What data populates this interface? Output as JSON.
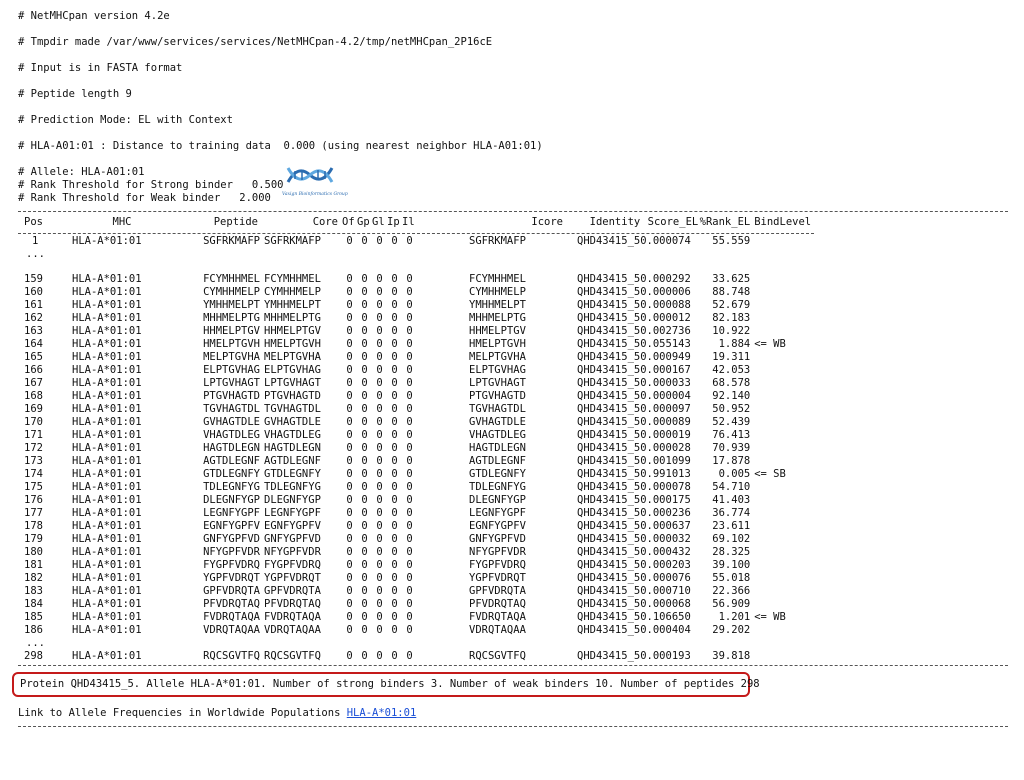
{
  "header": {
    "version": "# NetMHCpan version 4.2e",
    "tmpdir": "# Tmpdir made /var/www/services/services/NetMHCpan-4.2/tmp/netMHCpan_2P16cE",
    "input": "# Input is in FASTA format",
    "peptide_length": "# Peptide length 9",
    "prediction_mode": "# Prediction Mode: EL with Context",
    "distance": "# HLA-A01:01 : Distance to training data  0.000 (using nearest neighbor HLA-A01:01)",
    "allele": "# Allele: HLA-A01:01",
    "strong_threshold": "# Rank Threshold for Strong binder   0.500",
    "weak_threshold": "# Rank Threshold for Weak binder   2.000"
  },
  "logo": {
    "name": "dna-logo-icon",
    "caption": "Vaxign Bioinformatics Group",
    "color": "#2b6cb0"
  },
  "table": {
    "columns": [
      "Pos",
      "MHC",
      "Peptide",
      "Core",
      "Of",
      "Gp",
      "Gl",
      "Ip",
      "Il",
      "Icore",
      "Identity",
      "Score_EL",
      "%Rank_EL",
      "BindLevel"
    ],
    "first_row": {
      "pos": "1",
      "mhc": "HLA-A*01:01",
      "peptide": "SGFRKMAFP",
      "core": "SGFRKMAFP",
      "of": "0",
      "gp": "0",
      "gl": "0",
      "ip": "0",
      "il": "0",
      "icore": "SGFRKMAFP",
      "identity": "QHD43415_5",
      "score": "0.000074",
      "rank": "55.559",
      "bind": ""
    },
    "ellipsis": "...",
    "rows": [
      {
        "pos": "159",
        "mhc": "HLA-A*01:01",
        "peptide": "FCYMHHMEL",
        "core": "FCYMHHMEL",
        "icore": "FCYMHHMEL",
        "identity": "QHD43415_5",
        "score": "0.000292",
        "rank": "33.625",
        "bind": ""
      },
      {
        "pos": "160",
        "mhc": "HLA-A*01:01",
        "peptide": "CYMHHMELP",
        "core": "CYMHHMELP",
        "icore": "CYMHHMELP",
        "identity": "QHD43415_5",
        "score": "0.000006",
        "rank": "88.748",
        "bind": ""
      },
      {
        "pos": "161",
        "mhc": "HLA-A*01:01",
        "peptide": "YMHHMELPT",
        "core": "YMHHMELPT",
        "icore": "YMHHMELPT",
        "identity": "QHD43415_5",
        "score": "0.000088",
        "rank": "52.679",
        "bind": ""
      },
      {
        "pos": "162",
        "mhc": "HLA-A*01:01",
        "peptide": "MHHMELPTG",
        "core": "MHHMELPTG",
        "icore": "MHHMELPTG",
        "identity": "QHD43415_5",
        "score": "0.000012",
        "rank": "82.183",
        "bind": ""
      },
      {
        "pos": "163",
        "mhc": "HLA-A*01:01",
        "peptide": "HHMELPTGV",
        "core": "HHMELPTGV",
        "icore": "HHMELPTGV",
        "identity": "QHD43415_5",
        "score": "0.002736",
        "rank": "10.922",
        "bind": ""
      },
      {
        "pos": "164",
        "mhc": "HLA-A*01:01",
        "peptide": "HMELPTGVH",
        "core": "HMELPTGVH",
        "icore": "HMELPTGVH",
        "identity": "QHD43415_5",
        "score": "0.055143",
        "rank": "1.884",
        "bind": "<= WB"
      },
      {
        "pos": "165",
        "mhc": "HLA-A*01:01",
        "peptide": "MELPTGVHA",
        "core": "MELPTGVHA",
        "icore": "MELPTGVHA",
        "identity": "QHD43415_5",
        "score": "0.000949",
        "rank": "19.311",
        "bind": ""
      },
      {
        "pos": "166",
        "mhc": "HLA-A*01:01",
        "peptide": "ELPTGVHAG",
        "core": "ELPTGVHAG",
        "icore": "ELPTGVHAG",
        "identity": "QHD43415_5",
        "score": "0.000167",
        "rank": "42.053",
        "bind": ""
      },
      {
        "pos": "167",
        "mhc": "HLA-A*01:01",
        "peptide": "LPTGVHAGT",
        "core": "LPTGVHAGT",
        "icore": "LPTGVHAGT",
        "identity": "QHD43415_5",
        "score": "0.000033",
        "rank": "68.578",
        "bind": ""
      },
      {
        "pos": "168",
        "mhc": "HLA-A*01:01",
        "peptide": "PTGVHAGTD",
        "core": "PTGVHAGTD",
        "icore": "PTGVHAGTD",
        "identity": "QHD43415_5",
        "score": "0.000004",
        "rank": "92.140",
        "bind": ""
      },
      {
        "pos": "169",
        "mhc": "HLA-A*01:01",
        "peptide": "TGVHAGTDL",
        "core": "TGVHAGTDL",
        "icore": "TGVHAGTDL",
        "identity": "QHD43415_5",
        "score": "0.000097",
        "rank": "50.952",
        "bind": ""
      },
      {
        "pos": "170",
        "mhc": "HLA-A*01:01",
        "peptide": "GVHAGTDLE",
        "core": "GVHAGTDLE",
        "icore": "GVHAGTDLE",
        "identity": "QHD43415_5",
        "score": "0.000089",
        "rank": "52.439",
        "bind": ""
      },
      {
        "pos": "171",
        "mhc": "HLA-A*01:01",
        "peptide": "VHAGTDLEG",
        "core": "VHAGTDLEG",
        "icore": "VHAGTDLEG",
        "identity": "QHD43415_5",
        "score": "0.000019",
        "rank": "76.413",
        "bind": ""
      },
      {
        "pos": "172",
        "mhc": "HLA-A*01:01",
        "peptide": "HAGTDLEGN",
        "core": "HAGTDLEGN",
        "icore": "HAGTDLEGN",
        "identity": "QHD43415_5",
        "score": "0.000028",
        "rank": "70.939",
        "bind": ""
      },
      {
        "pos": "173",
        "mhc": "HLA-A*01:01",
        "peptide": "AGTDLEGNF",
        "core": "AGTDLEGNF",
        "icore": "AGTDLEGNF",
        "identity": "QHD43415_5",
        "score": "0.001099",
        "rank": "17.878",
        "bind": ""
      },
      {
        "pos": "174",
        "mhc": "HLA-A*01:01",
        "peptide": "GTDLEGNFY",
        "core": "GTDLEGNFY",
        "icore": "GTDLEGNFY",
        "identity": "QHD43415_5",
        "score": "0.991013",
        "rank": "0.005",
        "bind": "<= SB"
      },
      {
        "pos": "175",
        "mhc": "HLA-A*01:01",
        "peptide": "TDLEGNFYG",
        "core": "TDLEGNFYG",
        "icore": "TDLEGNFYG",
        "identity": "QHD43415_5",
        "score": "0.000078",
        "rank": "54.710",
        "bind": ""
      },
      {
        "pos": "176",
        "mhc": "HLA-A*01:01",
        "peptide": "DLEGNFYGP",
        "core": "DLEGNFYGP",
        "icore": "DLEGNFYGP",
        "identity": "QHD43415_5",
        "score": "0.000175",
        "rank": "41.403",
        "bind": ""
      },
      {
        "pos": "177",
        "mhc": "HLA-A*01:01",
        "peptide": "LEGNFYGPF",
        "core": "LEGNFYGPF",
        "icore": "LEGNFYGPF",
        "identity": "QHD43415_5",
        "score": "0.000236",
        "rank": "36.774",
        "bind": ""
      },
      {
        "pos": "178",
        "mhc": "HLA-A*01:01",
        "peptide": "EGNFYGPFV",
        "core": "EGNFYGPFV",
        "icore": "EGNFYGPFV",
        "identity": "QHD43415_5",
        "score": "0.000637",
        "rank": "23.611",
        "bind": ""
      },
      {
        "pos": "179",
        "mhc": "HLA-A*01:01",
        "peptide": "GNFYGPFVD",
        "core": "GNFYGPFVD",
        "icore": "GNFYGPFVD",
        "identity": "QHD43415_5",
        "score": "0.000032",
        "rank": "69.102",
        "bind": ""
      },
      {
        "pos": "180",
        "mhc": "HLA-A*01:01",
        "peptide": "NFYGPFVDR",
        "core": "NFYGPFVDR",
        "icore": "NFYGPFVDR",
        "identity": "QHD43415_5",
        "score": "0.000432",
        "rank": "28.325",
        "bind": ""
      },
      {
        "pos": "181",
        "mhc": "HLA-A*01:01",
        "peptide": "FYGPFVDRQ",
        "core": "FYGPFVDRQ",
        "icore": "FYGPFVDRQ",
        "identity": "QHD43415_5",
        "score": "0.000203",
        "rank": "39.100",
        "bind": ""
      },
      {
        "pos": "182",
        "mhc": "HLA-A*01:01",
        "peptide": "YGPFVDRQT",
        "core": "YGPFVDRQT",
        "icore": "YGPFVDRQT",
        "identity": "QHD43415_5",
        "score": "0.000076",
        "rank": "55.018",
        "bind": ""
      },
      {
        "pos": "183",
        "mhc": "HLA-A*01:01",
        "peptide": "GPFVDRQTA",
        "core": "GPFVDRQTA",
        "icore": "GPFVDRQTA",
        "identity": "QHD43415_5",
        "score": "0.000710",
        "rank": "22.366",
        "bind": ""
      },
      {
        "pos": "184",
        "mhc": "HLA-A*01:01",
        "peptide": "PFVDRQTAQ",
        "core": "PFVDRQTAQ",
        "icore": "PFVDRQTAQ",
        "identity": "QHD43415_5",
        "score": "0.000068",
        "rank": "56.909",
        "bind": ""
      },
      {
        "pos": "185",
        "mhc": "HLA-A*01:01",
        "peptide": "FVDRQTAQA",
        "core": "FVDRQTAQA",
        "icore": "FVDRQTAQA",
        "identity": "QHD43415_5",
        "score": "0.106650",
        "rank": "1.201",
        "bind": "<= WB"
      },
      {
        "pos": "186",
        "mhc": "HLA-A*01:01",
        "peptide": "VDRQTAQAA",
        "core": "VDRQTAQAA",
        "icore": "VDRQTAQAA",
        "identity": "QHD43415_5",
        "score": "0.000404",
        "rank": "29.202",
        "bind": ""
      }
    ],
    "last_row": {
      "pos": "298",
      "mhc": "HLA-A*01:01",
      "peptide": "RQCSGVTFQ",
      "core": "RQCSGVTFQ",
      "of": "0",
      "gp": "0",
      "gl": "0",
      "ip": "0",
      "il": "0",
      "icore": "RQCSGVTFQ",
      "identity": "QHD43415_5",
      "score": "0.000193",
      "rank": "39.818",
      "bind": ""
    }
  },
  "summary": "Protein QHD43415_5. Allele HLA-A*01:01. Number of strong binders 3. Number of weak binders 10. Number of peptides 298",
  "footer": {
    "link_prefix": "Link to Allele Frequencies in Worldwide Populations ",
    "link_text": "HLA-A*01:01"
  },
  "colors": {
    "summary_border": "#c41a1a",
    "link": "#1a4fd6"
  }
}
